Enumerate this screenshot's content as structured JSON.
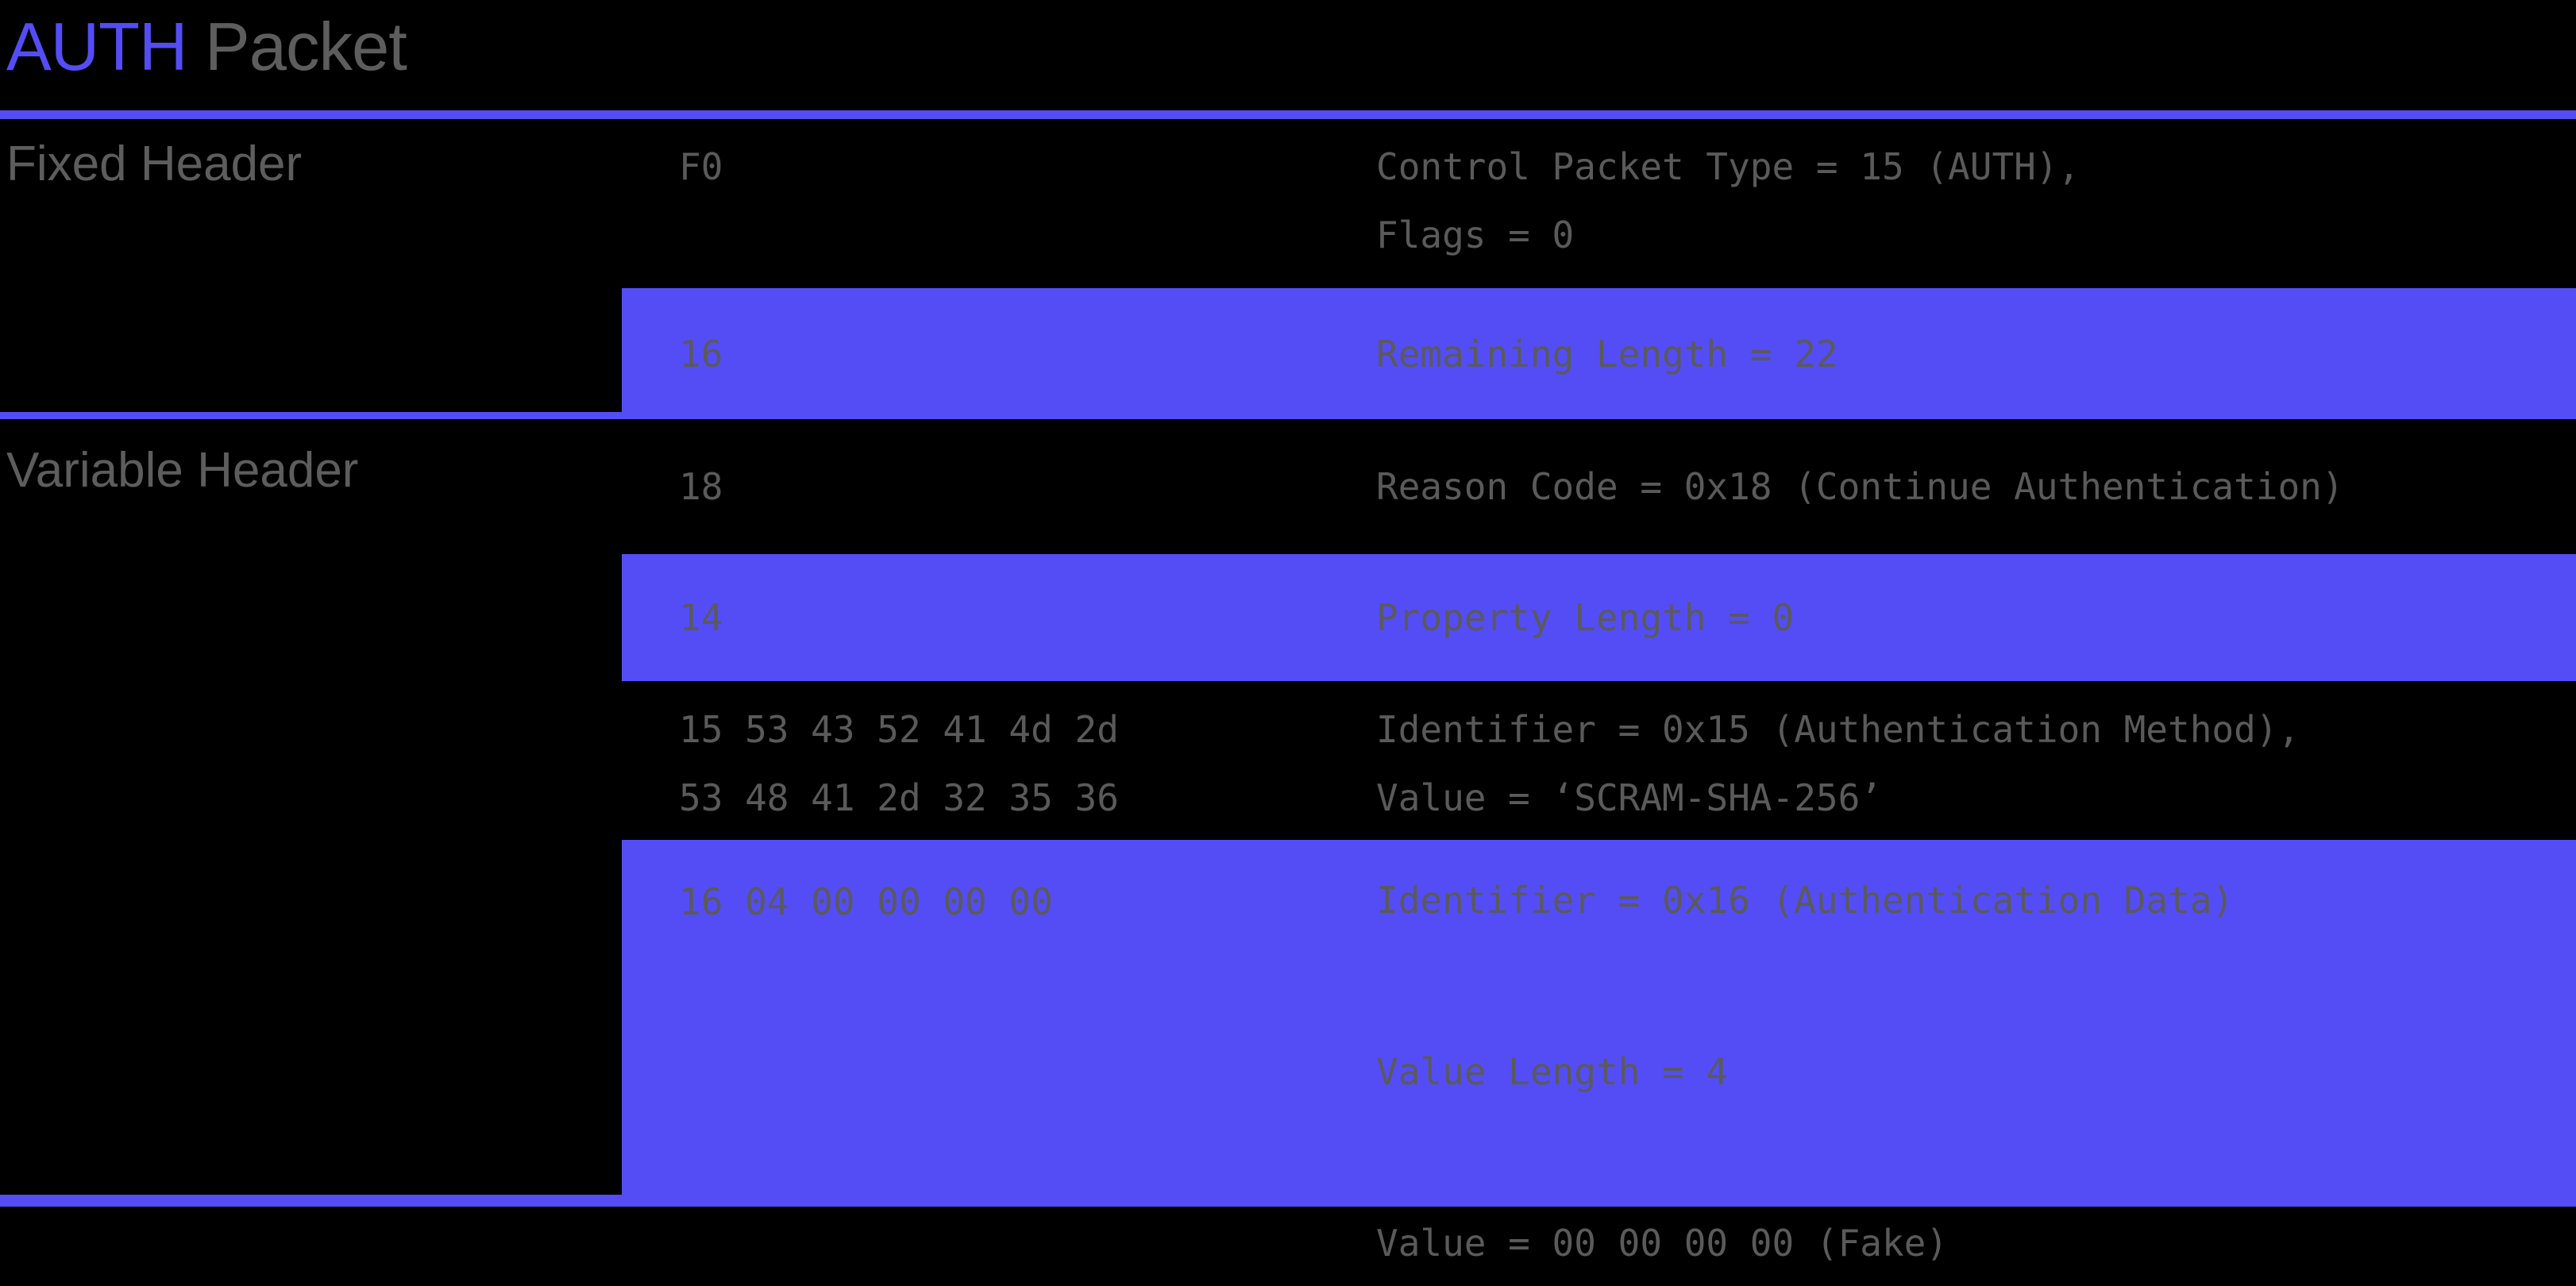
{
  "title": {
    "accent": "AUTH",
    "rest": " Packet"
  },
  "colors": {
    "accent": "#544df5",
    "text": "#5a5a5a",
    "background": "#000000"
  },
  "sections": [
    {
      "label": "Fixed Header"
    },
    {
      "label": "Variable Header"
    }
  ],
  "rows": [
    {
      "section": "Fixed Header",
      "highlighted": false,
      "hex": "F0",
      "description": "Control Packet Type = 15 (AUTH),\nFlags = 0"
    },
    {
      "section": "Fixed Header",
      "highlighted": true,
      "hex": "16",
      "description": "Remaining Length = 22"
    },
    {
      "section": "Variable Header",
      "highlighted": false,
      "hex": "18",
      "description": "Reason Code = 0x18 (Continue Authentication)"
    },
    {
      "section": "Variable Header",
      "highlighted": true,
      "hex": "14",
      "description": "Property Length = 0"
    },
    {
      "section": "Variable Header",
      "highlighted": false,
      "hex": "15 53 43 52 41 4d 2d\n53 48 41 2d 32 35 36",
      "description": "Identifier = 0x15 (Authentication Method),\nValue = ‘SCRAM-SHA-256’"
    },
    {
      "section": "Variable Header",
      "highlighted": true,
      "hex": "16 04 00 00 00 00",
      "description": "Identifier = 0x16 (Authentication Data)\n\nValue Length = 4\n\nValue = 00 00 00 00 (Fake)"
    }
  ]
}
